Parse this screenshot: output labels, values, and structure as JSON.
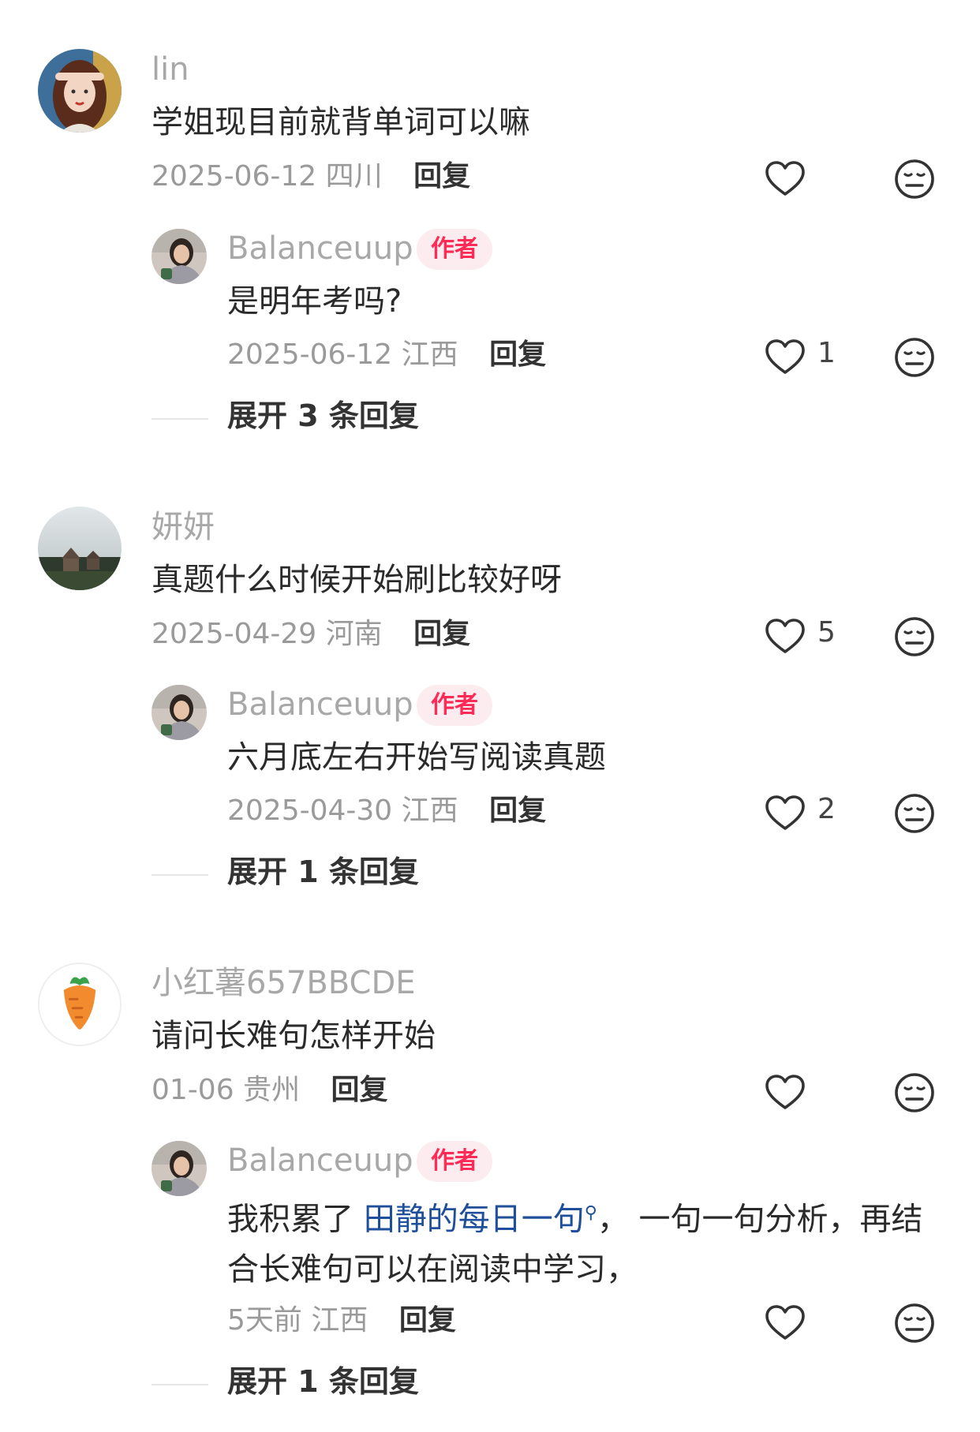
{
  "comments": [
    {
      "user": "lin",
      "content": "学姐现目前就背单词可以嘛",
      "date": "2025-06-12",
      "location": "四川",
      "reply_label": "回复",
      "likes": "",
      "reply": {
        "user": "Balanceuup",
        "badge": "作者",
        "content": "是明年考吗?",
        "date": "2025-06-12",
        "location": "江西",
        "reply_label": "回复",
        "likes": "1",
        "expand": "展开 3 条回复"
      }
    },
    {
      "user": "妍妍",
      "content": "真题什么时候开始刷比较好呀",
      "date": "2025-04-29",
      "location": "河南",
      "reply_label": "回复",
      "likes": "5",
      "reply": {
        "user": "Balanceuup",
        "badge": "作者",
        "content": "六月底左右开始写阅读真题",
        "date": "2025-04-30",
        "location": "江西",
        "reply_label": "回复",
        "likes": "2",
        "expand": "展开 1 条回复"
      }
    },
    {
      "user": "小红薯657BBCDE",
      "content": "请问长难句怎样开始",
      "date": "01-06",
      "location": "贵州",
      "reply_label": "回复",
      "likes": "",
      "reply": {
        "user": "Balanceuup",
        "badge": "作者",
        "content_prefix": "我积累了 ",
        "content_link": "田静的每日一句",
        "content_suffix": "， 一句一句分析，再结合长难句可以在阅读中学习，",
        "date": "5天前",
        "location": "江西",
        "reply_label": "回复",
        "likes": "",
        "expand": "展开 1 条回复"
      }
    }
  ],
  "icons": {
    "like": "heart-outline-icon",
    "dislike": "meh-face-icon",
    "link_search": "search-icon"
  },
  "colors": {
    "author_badge_bg": "#fdecef",
    "author_badge_text": "#ff2a55",
    "link": "#1f4f9a"
  }
}
